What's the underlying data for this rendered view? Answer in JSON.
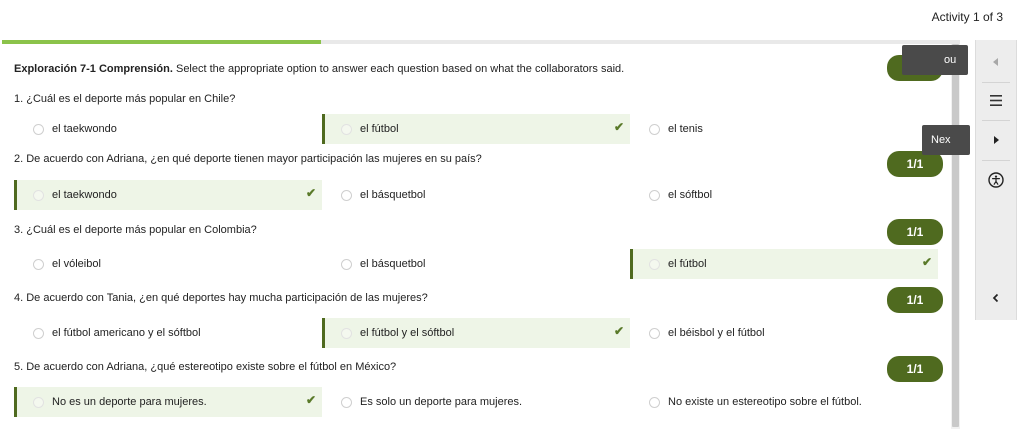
{
  "header": {
    "activity_counter": "Activity 1 of 3",
    "progress_fraction": 0.333
  },
  "instructions": {
    "bold": "Exploración 7-1 Comprensión.",
    "text": " Select the appropriate option to answer each question based on what the collaborators said."
  },
  "questions": [
    {
      "text": "1. ¿Cuál es el deporte más popular en Chile?",
      "score": "1/1",
      "options": [
        "el taekwondo",
        "el fútbol",
        "el tenis"
      ],
      "selected_index": 1
    },
    {
      "text": "2. De acuerdo con Adriana, ¿en qué deporte tienen mayor participación las mujeres en su país?",
      "score": "1/1",
      "options": [
        "el taekwondo",
        "el básquetbol",
        "el sóftbol"
      ],
      "selected_index": 0
    },
    {
      "text": "3. ¿Cuál es el deporte más popular en Colombia?",
      "score": "1/1",
      "options": [
        "el vóleibol",
        "el básquetbol",
        "el fútbol"
      ],
      "selected_index": 2
    },
    {
      "text": "4. De acuerdo con Tania, ¿en qué deportes hay mucha participación de las mujeres?",
      "score": "1/1",
      "options": [
        "el fútbol americano y el sóftbol",
        "el fútbol y el sóftbol",
        "el béisbol y el fútbol"
      ],
      "selected_index": 1
    },
    {
      "text": "5. De acuerdo con Adriana, ¿qué estereotipo existe sobre el fútbol en México?",
      "score": "1/1",
      "options": [
        "No es un deporte para mujeres.",
        "Es solo un deporte para mujeres.",
        "No existe un estereotipo sobre el fútbol."
      ],
      "selected_index": 0
    }
  ],
  "side_panel": {
    "previous_icon": "triangle-left-icon",
    "menu_icon": "hamburger-menu-icon",
    "next_icon": "triangle-right-icon",
    "accessibility_icon": "accessibility-icon",
    "collapse_icon": "chevron-left-icon",
    "previous_tooltip": "ou",
    "next_tooltip": "Nex"
  },
  "colors": {
    "accent_green": "#4f6a1f",
    "progress_green": "#8bc34a",
    "selected_bg": "#eef5e7"
  }
}
